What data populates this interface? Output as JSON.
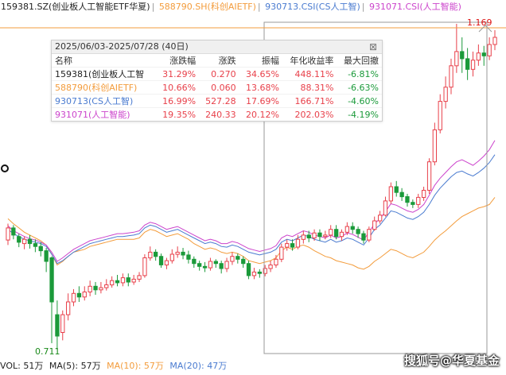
{
  "legend": [
    {
      "label": "159381.SZ(创业板人工智能ETF华夏)",
      "color": "#222222"
    },
    {
      "label": "588790.SH(科创AIETF)",
      "color": "#f39c3c"
    },
    {
      "label": "930713.CSI(CS人工智)",
      "color": "#4a7bd0"
    },
    {
      "label": "931071.CSI(人工智能)",
      "color": "#cc44cc"
    }
  ],
  "stats": {
    "period": "2025/06/03-2025/07/28 (40日)",
    "headers": [
      "名称",
      "涨跌幅",
      "涨跌",
      "振幅",
      "年化收益率",
      "最大回撤"
    ],
    "rows": [
      {
        "name": "159381(创业板人工智",
        "color": "#222222",
        "cells": [
          "31.29%",
          "0.270",
          "34.65%",
          "448.11%",
          "-6.81%"
        ]
      },
      {
        "name": "588790(科创AIETF)",
        "color": "#f39c3c",
        "cells": [
          "10.66%",
          "0.060",
          "13.68%",
          "88.31%",
          "-6.63%"
        ]
      },
      {
        "name": "930713(CS人工智)",
        "color": "#4a7bd0",
        "cells": [
          "16.99%",
          "527.28",
          "17.69%",
          "166.71%",
          "-4.60%"
        ]
      },
      {
        "name": "931071(人工智能)",
        "color": "#cc44cc",
        "cells": [
          "19.35%",
          "240.33",
          "20.12%",
          "202.03%",
          "-4.19%"
        ]
      }
    ],
    "close_glyph": "⊠"
  },
  "labels": {
    "max": "1.169",
    "min": "0.711"
  },
  "bottom": [
    {
      "text": "VOL: 51万",
      "color": "#222222"
    },
    {
      "text": "MA(5): 57万",
      "color": "#222222"
    },
    {
      "text": "MA(10): 57万",
      "color": "#f39c3c"
    },
    {
      "text": "MA(20): 47万",
      "color": "#4a7bd0"
    }
  ],
  "watermark": "搜狐号@华夏基金",
  "colors": {
    "up": "#e8404a",
    "down": "#1b9a3a",
    "etf588790": "#f39c3c",
    "csi930713": "#4a7bd0",
    "csi931071": "#cc44cc",
    "refline": "#f39c3c"
  },
  "chart_data": {
    "type": "candlestick",
    "y_reference": {
      "max": 1.169,
      "min": 0.711
    },
    "candles": [
      [
        0.865,
        0.882,
        0.888,
        0.858
      ],
      [
        0.882,
        0.872,
        0.886,
        0.866
      ],
      [
        0.87,
        0.862,
        0.874,
        0.855
      ],
      [
        0.86,
        0.866,
        0.87,
        0.852
      ],
      [
        0.866,
        0.86,
        0.872,
        0.853
      ],
      [
        0.86,
        0.856,
        0.866,
        0.848
      ],
      [
        0.856,
        0.85,
        0.862,
        0.842
      ],
      [
        0.85,
        0.835,
        0.854,
        0.82
      ],
      [
        0.84,
        0.778,
        0.842,
        0.72
      ],
      [
        0.76,
        0.73,
        0.78,
        0.711
      ],
      [
        0.735,
        0.76,
        0.766,
        0.724
      ],
      [
        0.76,
        0.778,
        0.79,
        0.752
      ],
      [
        0.778,
        0.79,
        0.796,
        0.772
      ],
      [
        0.79,
        0.785,
        0.8,
        0.778
      ],
      [
        0.785,
        0.792,
        0.8,
        0.78
      ],
      [
        0.792,
        0.8,
        0.808,
        0.786
      ],
      [
        0.8,
        0.795,
        0.806,
        0.788
      ],
      [
        0.795,
        0.798,
        0.806,
        0.79
      ],
      [
        0.798,
        0.802,
        0.81,
        0.794
      ],
      [
        0.802,
        0.808,
        0.814,
        0.798
      ],
      [
        0.808,
        0.805,
        0.816,
        0.8
      ],
      [
        0.805,
        0.812,
        0.818,
        0.8
      ],
      [
        0.812,
        0.806,
        0.818,
        0.8
      ],
      [
        0.806,
        0.81,
        0.816,
        0.802
      ],
      [
        0.81,
        0.815,
        0.82,
        0.806
      ],
      [
        0.815,
        0.84,
        0.845,
        0.812
      ],
      [
        0.84,
        0.848,
        0.856,
        0.836
      ],
      [
        0.848,
        0.842,
        0.852,
        0.836
      ],
      [
        0.842,
        0.83,
        0.846,
        0.826
      ],
      [
        0.83,
        0.836,
        0.84,
        0.824
      ],
      [
        0.836,
        0.845,
        0.852,
        0.832
      ],
      [
        0.845,
        0.848,
        0.856,
        0.84
      ],
      [
        0.848,
        0.844,
        0.854,
        0.838
      ],
      [
        0.844,
        0.838,
        0.85,
        0.832
      ],
      [
        0.838,
        0.832,
        0.842,
        0.826
      ],
      [
        0.832,
        0.828,
        0.836,
        0.822
      ],
      [
        0.828,
        0.826,
        0.834,
        0.82
      ],
      [
        0.826,
        0.835,
        0.84,
        0.822
      ],
      [
        0.835,
        0.832,
        0.838,
        0.826
      ],
      [
        0.832,
        0.825,
        0.836,
        0.818
      ],
      [
        0.825,
        0.835,
        0.84,
        0.82
      ],
      [
        0.835,
        0.842,
        0.848,
        0.83
      ],
      [
        0.842,
        0.838,
        0.846,
        0.832
      ],
      [
        0.838,
        0.832,
        0.842,
        0.826
      ],
      [
        0.832,
        0.815,
        0.836,
        0.81
      ],
      [
        0.815,
        0.82,
        0.826,
        0.81
      ],
      [
        0.82,
        0.818,
        0.824,
        0.812
      ],
      [
        0.818,
        0.825,
        0.83,
        0.814
      ],
      [
        0.825,
        0.83,
        0.836,
        0.82
      ],
      [
        0.83,
        0.838,
        0.844,
        0.826
      ],
      [
        0.838,
        0.855,
        0.86,
        0.834
      ],
      [
        0.855,
        0.86,
        0.866,
        0.85
      ],
      [
        0.86,
        0.855,
        0.866,
        0.85
      ],
      [
        0.855,
        0.866,
        0.872,
        0.852
      ],
      [
        0.866,
        0.872,
        0.878,
        0.86
      ],
      [
        0.872,
        0.868,
        0.878,
        0.862
      ],
      [
        0.868,
        0.875,
        0.88,
        0.864
      ],
      [
        0.875,
        0.87,
        0.88,
        0.864
      ],
      [
        0.87,
        0.872,
        0.878,
        0.866
      ],
      [
        0.872,
        0.88,
        0.886,
        0.868
      ],
      [
        0.88,
        0.87,
        0.886,
        0.866
      ],
      [
        0.87,
        0.876,
        0.88,
        0.864
      ],
      [
        0.876,
        0.884,
        0.89,
        0.872
      ],
      [
        0.884,
        0.88,
        0.89,
        0.874
      ],
      [
        0.88,
        0.874,
        0.884,
        0.868
      ],
      [
        0.874,
        0.865,
        0.878,
        0.86
      ],
      [
        0.865,
        0.88,
        0.884,
        0.862
      ],
      [
        0.88,
        0.892,
        0.898,
        0.878
      ],
      [
        0.892,
        0.9,
        0.906,
        0.888
      ],
      [
        0.9,
        0.92,
        0.926,
        0.898
      ],
      [
        0.92,
        0.94,
        0.946,
        0.916
      ],
      [
        0.94,
        0.932,
        0.948,
        0.926
      ],
      [
        0.932,
        0.926,
        0.938,
        0.92
      ],
      [
        0.926,
        0.918,
        0.93,
        0.912
      ],
      [
        0.918,
        0.915,
        0.922,
        0.91
      ],
      [
        0.915,
        0.925,
        0.93,
        0.91
      ],
      [
        0.925,
        0.935,
        0.94,
        0.92
      ],
      [
        0.935,
        0.975,
        0.98,
        0.93
      ],
      [
        0.975,
        1.02,
        1.03,
        0.97
      ],
      [
        1.02,
        1.06,
        1.07,
        1.015
      ],
      [
        1.06,
        1.08,
        1.095,
        1.05
      ],
      [
        1.08,
        1.11,
        1.12,
        1.07
      ],
      [
        1.11,
        1.13,
        1.169,
        1.1
      ],
      [
        1.13,
        1.12,
        1.15,
        1.1
      ],
      [
        1.12,
        1.105,
        1.135,
        1.09
      ],
      [
        1.105,
        1.118,
        1.13,
        1.095
      ],
      [
        1.118,
        1.128,
        1.14,
        1.11
      ],
      [
        1.128,
        1.124,
        1.138,
        1.11
      ],
      [
        1.124,
        1.14,
        1.15,
        1.118
      ],
      [
        1.14,
        1.15,
        1.16,
        1.132
      ]
    ],
    "series": [
      {
        "key": "etf588790",
        "values": [
          0.895,
          0.888,
          0.882,
          0.876,
          0.872,
          0.868,
          0.864,
          0.858,
          0.845,
          0.83,
          0.835,
          0.842,
          0.848,
          0.85,
          0.852,
          0.856,
          0.858,
          0.86,
          0.862,
          0.864,
          0.866,
          0.866,
          0.866,
          0.866,
          0.868,
          0.876,
          0.88,
          0.878,
          0.874,
          0.87,
          0.872,
          0.874,
          0.87,
          0.866,
          0.86,
          0.856,
          0.852,
          0.854,
          0.852,
          0.848,
          0.846,
          0.848,
          0.846,
          0.842,
          0.836,
          0.834,
          0.832,
          0.834,
          0.836,
          0.84,
          0.85,
          0.855,
          0.852,
          0.856,
          0.858,
          0.855,
          0.85,
          0.846,
          0.842,
          0.84,
          0.836,
          0.834,
          0.832,
          0.83,
          0.826,
          0.824,
          0.828,
          0.835,
          0.84,
          0.846,
          0.852,
          0.85,
          0.846,
          0.842,
          0.84,
          0.844,
          0.848,
          0.856,
          0.865,
          0.872,
          0.878,
          0.885,
          0.892,
          0.898,
          0.902,
          0.906,
          0.91,
          0.912,
          0.915,
          0.925
        ]
      },
      {
        "key": "csi930713",
        "values": [
          0.88,
          0.874,
          0.87,
          0.866,
          0.864,
          0.862,
          0.86,
          0.856,
          0.845,
          0.832,
          0.836,
          0.842,
          0.848,
          0.852,
          0.856,
          0.86,
          0.862,
          0.864,
          0.866,
          0.868,
          0.87,
          0.87,
          0.871,
          0.872,
          0.874,
          0.882,
          0.886,
          0.884,
          0.88,
          0.876,
          0.878,
          0.88,
          0.876,
          0.872,
          0.868,
          0.864,
          0.86,
          0.862,
          0.86,
          0.856,
          0.855,
          0.858,
          0.856,
          0.852,
          0.848,
          0.846,
          0.844,
          0.846,
          0.848,
          0.852,
          0.862,
          0.866,
          0.864,
          0.868,
          0.872,
          0.87,
          0.866,
          0.864,
          0.862,
          0.866,
          0.862,
          0.864,
          0.868,
          0.866,
          0.862,
          0.858,
          0.868,
          0.88,
          0.886,
          0.896,
          0.906,
          0.904,
          0.9,
          0.896,
          0.894,
          0.898,
          0.904,
          0.915,
          0.928,
          0.938,
          0.946,
          0.954,
          0.96,
          0.962,
          0.958,
          0.955,
          0.96,
          0.966,
          0.974,
          0.985
        ]
      },
      {
        "key": "csi931071",
        "values": [
          0.885,
          0.878,
          0.874,
          0.87,
          0.867,
          0.865,
          0.862,
          0.858,
          0.848,
          0.835,
          0.84,
          0.846,
          0.852,
          0.856,
          0.86,
          0.864,
          0.866,
          0.868,
          0.87,
          0.872,
          0.874,
          0.874,
          0.875,
          0.876,
          0.878,
          0.886,
          0.89,
          0.888,
          0.884,
          0.88,
          0.882,
          0.884,
          0.88,
          0.876,
          0.872,
          0.868,
          0.864,
          0.866,
          0.864,
          0.86,
          0.86,
          0.863,
          0.861,
          0.857,
          0.853,
          0.851,
          0.849,
          0.851,
          0.853,
          0.857,
          0.868,
          0.872,
          0.87,
          0.874,
          0.878,
          0.876,
          0.872,
          0.87,
          0.868,
          0.872,
          0.868,
          0.87,
          0.875,
          0.873,
          0.869,
          0.865,
          0.876,
          0.888,
          0.895,
          0.905,
          0.916,
          0.914,
          0.91,
          0.906,
          0.904,
          0.908,
          0.915,
          0.928,
          0.942,
          0.952,
          0.96,
          0.968,
          0.975,
          0.978,
          0.974,
          0.97,
          0.976,
          0.983,
          0.992,
          1.005
        ]
      }
    ]
  }
}
